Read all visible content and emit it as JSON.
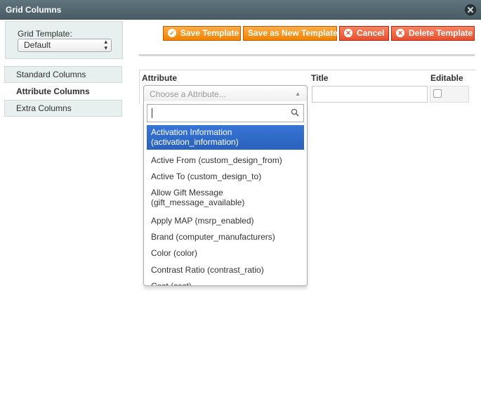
{
  "window": {
    "title": "Grid Columns"
  },
  "template": {
    "label": "Grid Template:",
    "selected": "Default"
  },
  "tabs": [
    "Standard Columns",
    "Attribute Columns",
    "Extra Columns"
  ],
  "buttons": {
    "save": "Save Template",
    "save_new": "Save as New Template",
    "cancel": "Cancel",
    "delete": "Delete Template"
  },
  "grid": {
    "col_attribute": "Attribute",
    "col_title": "Title",
    "col_editable": "Editable",
    "placeholder": "Choose a Attribute..."
  },
  "dropdown": {
    "options": [
      [
        "Activation Information",
        "(activation_information)"
      ],
      [
        "Active From (custom_design_from)"
      ],
      [
        "Active To (custom_design_to)"
      ],
      [
        "Allow Gift Message",
        "(gift_message_available)"
      ],
      [
        "Apply MAP (msrp_enabled)"
      ],
      [
        "Brand (computer_manufacturers)"
      ],
      [
        "Color (color)"
      ],
      [
        "Contrast Ratio (contrast_ratio)"
      ],
      [
        "Cost (cost)"
      ]
    ]
  },
  "colors": {
    "orange": "#f18200",
    "red": "#e74f30",
    "highlight": "#3875d7",
    "panel": "#e7efef",
    "titlebar": "#4a5d66"
  }
}
